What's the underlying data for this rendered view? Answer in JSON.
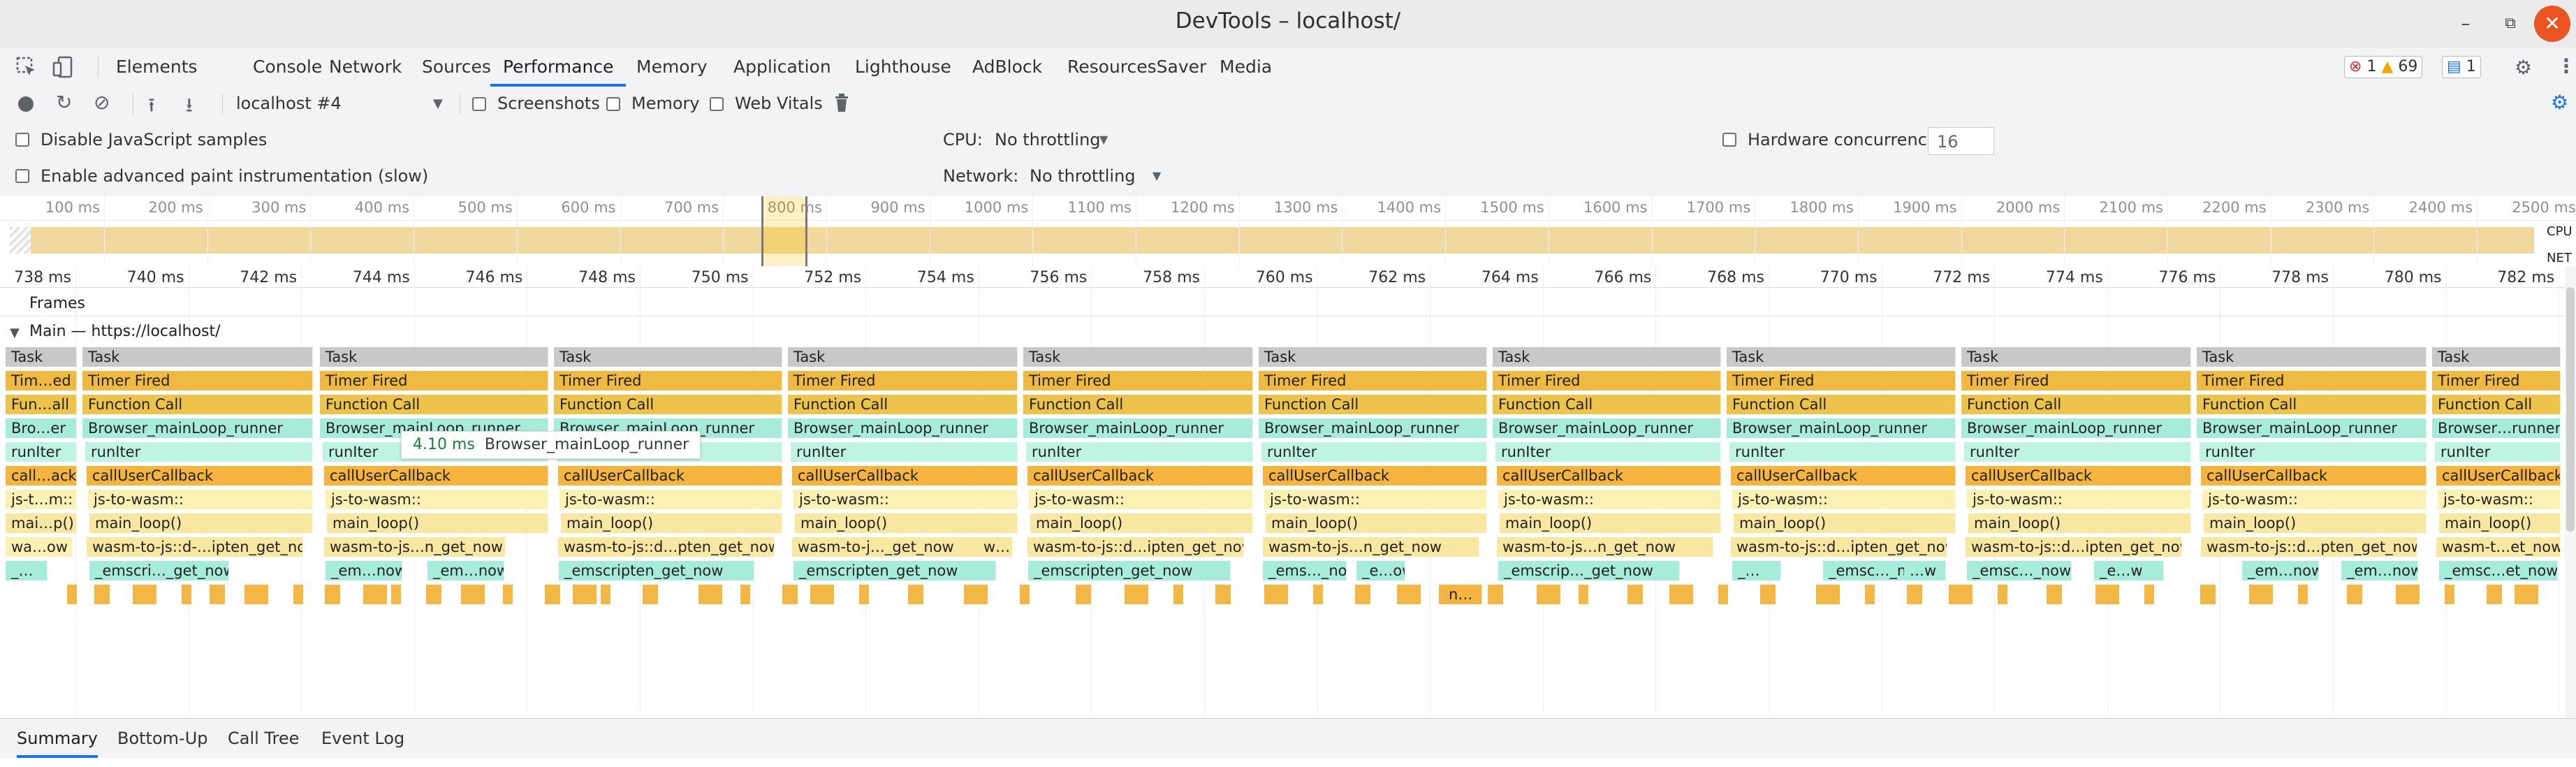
{
  "window": {
    "title": "DevTools – localhost/",
    "minimize_glyph": "–",
    "restore_glyph": "⧉",
    "close_glyph": "✕"
  },
  "main_tabs": [
    "Elements",
    "Console",
    "Network",
    "Sources",
    "Performance",
    "Memory",
    "Application",
    "Lighthouse",
    "AdBlock",
    "ResourcesSaver",
    "Media"
  ],
  "active_main_tab": "Performance",
  "badges": {
    "errors": "1",
    "warnings": "69",
    "messages": "1"
  },
  "perf_toolbar": {
    "profile_select": "localhost #4",
    "screenshots_label": "Screenshots",
    "memory_label": "Memory",
    "web_vitals_label": "Web Vitals"
  },
  "settings": {
    "disable_js_samples_label": "Disable JavaScript samples",
    "advanced_paint_label": "Enable advanced paint instrumentation (slow)",
    "cpu_label": "CPU:",
    "cpu_value": "No throttling",
    "network_label": "Network:",
    "network_value": "No throttling",
    "hardware_concurrency_label": "Hardware concurrency",
    "hardware_concurrency_value": "16"
  },
  "overview": {
    "ticks": [
      "100 ms",
      "200 ms",
      "300 ms",
      "400 ms",
      "500 ms",
      "600 ms",
      "700 ms",
      "800 ms",
      "900 ms",
      "1000 ms",
      "1100 ms",
      "1200 ms",
      "1300 ms",
      "1400 ms",
      "1500 ms",
      "1600 ms",
      "1700 ms",
      "1800 ms",
      "1900 ms",
      "2000 ms",
      "2100 ms",
      "2200 ms",
      "2300 ms",
      "2400 ms",
      "2500 ms"
    ],
    "cpu_label": "CPU",
    "net_label": "NET"
  },
  "ruler_ticks": [
    "738 ms",
    "740 ms",
    "742 ms",
    "744 ms",
    "746 ms",
    "748 ms",
    "750 ms",
    "752 ms",
    "754 ms",
    "756 ms",
    "758 ms",
    "760 ms",
    "762 ms",
    "764 ms",
    "766 ms",
    "768 ms",
    "770 ms",
    "772 ms",
    "774 ms",
    "776 ms",
    "778 ms",
    "780 ms",
    "782 ms"
  ],
  "tracks": {
    "frames_label": "Frames",
    "main_label": "Main — https://localhost/"
  },
  "flame": {
    "first_column": [
      "Task",
      "Tim…ed",
      "Fun…all",
      "Bro…er",
      "runIter",
      "call…ack",
      "js-t…m::",
      "mai…p()",
      "wa…ow",
      "_…"
    ],
    "row_labels": [
      "Task",
      "Timer Fired",
      "Function Call",
      "Browser_mainLoop_runner",
      "runIter",
      "callUserCallback",
      "js-to-wasm::",
      "main_loop()"
    ],
    "wasm_labels": [
      "wasm-to-js::d-…ipten_get_now",
      "wasm-to-js…n_get_now",
      "wasm-to-js::d…pten_get_now",
      "wasm-to-j…_get_now",
      "wasm-to-js::d…ipten_get_now",
      "wasm-to-js…n_get_now",
      "wasm-to-js…n_get_now",
      "wasm-to-js::d…ipten_get_now",
      "wasm-to-js::d…ipten_get_now",
      "wasm-to-js::d…pten_get_now",
      "wasm-t…et_now"
    ],
    "emsc_labels": [
      "_emscri…_get_now",
      "_em…now",
      "_em…now",
      "_emscripten_get_now",
      "_emscripten_get_now",
      "_emscripten_get_now",
      "_ems…_now",
      "_e…ow",
      "_emscrip…_get_now",
      "_…",
      "_emsc…_now",
      "…w",
      "_emsc…_now",
      "_e…w",
      "_em…now",
      "_em…now",
      "_em…now",
      "_emsc…et_now"
    ],
    "extra_labels": [
      "w…",
      "n…"
    ],
    "last_browser": "Browser…runner"
  },
  "tooltip": {
    "duration": "4.10 ms",
    "name": "Browser_mainLoop_runner"
  },
  "bottom_tabs": [
    "Summary",
    "Bottom-Up",
    "Call Tree",
    "Event Log"
  ],
  "active_bottom_tab": "Summary",
  "colors": {
    "accent": "#1a73e8",
    "task": "#c8c8c8",
    "scripting": "#f0b941",
    "teal": "#a7ecda",
    "close_button": "#e95420"
  }
}
